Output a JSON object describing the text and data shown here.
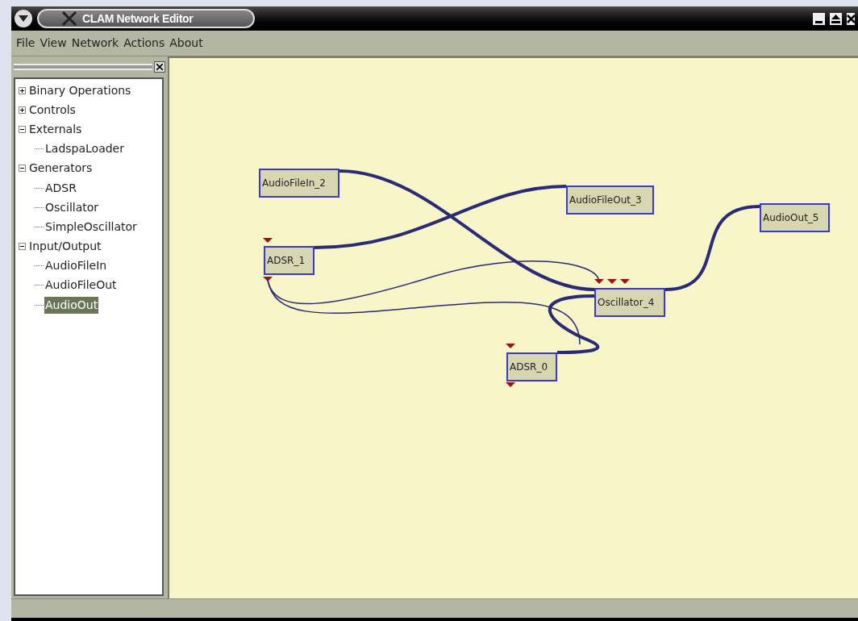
{
  "window": {
    "title": "CLAM Network Editor"
  },
  "menu": [
    "File",
    "View",
    "Network",
    "Actions",
    "About"
  ],
  "tree": [
    {
      "label": "Binary Operations",
      "expanded": false,
      "selected": false
    },
    {
      "label": "Controls",
      "expanded": false,
      "selected": false
    },
    {
      "label": "Externals",
      "expanded": true,
      "selected": false,
      "children": [
        {
          "label": "LadspaLoader",
          "selected": false
        }
      ]
    },
    {
      "label": "Generators",
      "expanded": true,
      "selected": false,
      "children": [
        {
          "label": "ADSR",
          "selected": false
        },
        {
          "label": "Oscillator",
          "selected": false
        },
        {
          "label": "SimpleOscillator",
          "selected": false
        }
      ]
    },
    {
      "label": "Input/Output",
      "expanded": true,
      "selected": false,
      "children": [
        {
          "label": "AudioFileIn",
          "selected": false
        },
        {
          "label": "AudioFileOut",
          "selected": false
        },
        {
          "label": "AudioOut",
          "selected": true
        }
      ]
    }
  ],
  "network": {
    "nodes": [
      {
        "name": "AudioFileIn_2"
      },
      {
        "name": "AudioFileOut_3"
      },
      {
        "name": "ADSR_1"
      },
      {
        "name": "Oscillator_4"
      },
      {
        "name": "ADSR_0"
      },
      {
        "name": "AudioOut_5"
      }
    ]
  }
}
